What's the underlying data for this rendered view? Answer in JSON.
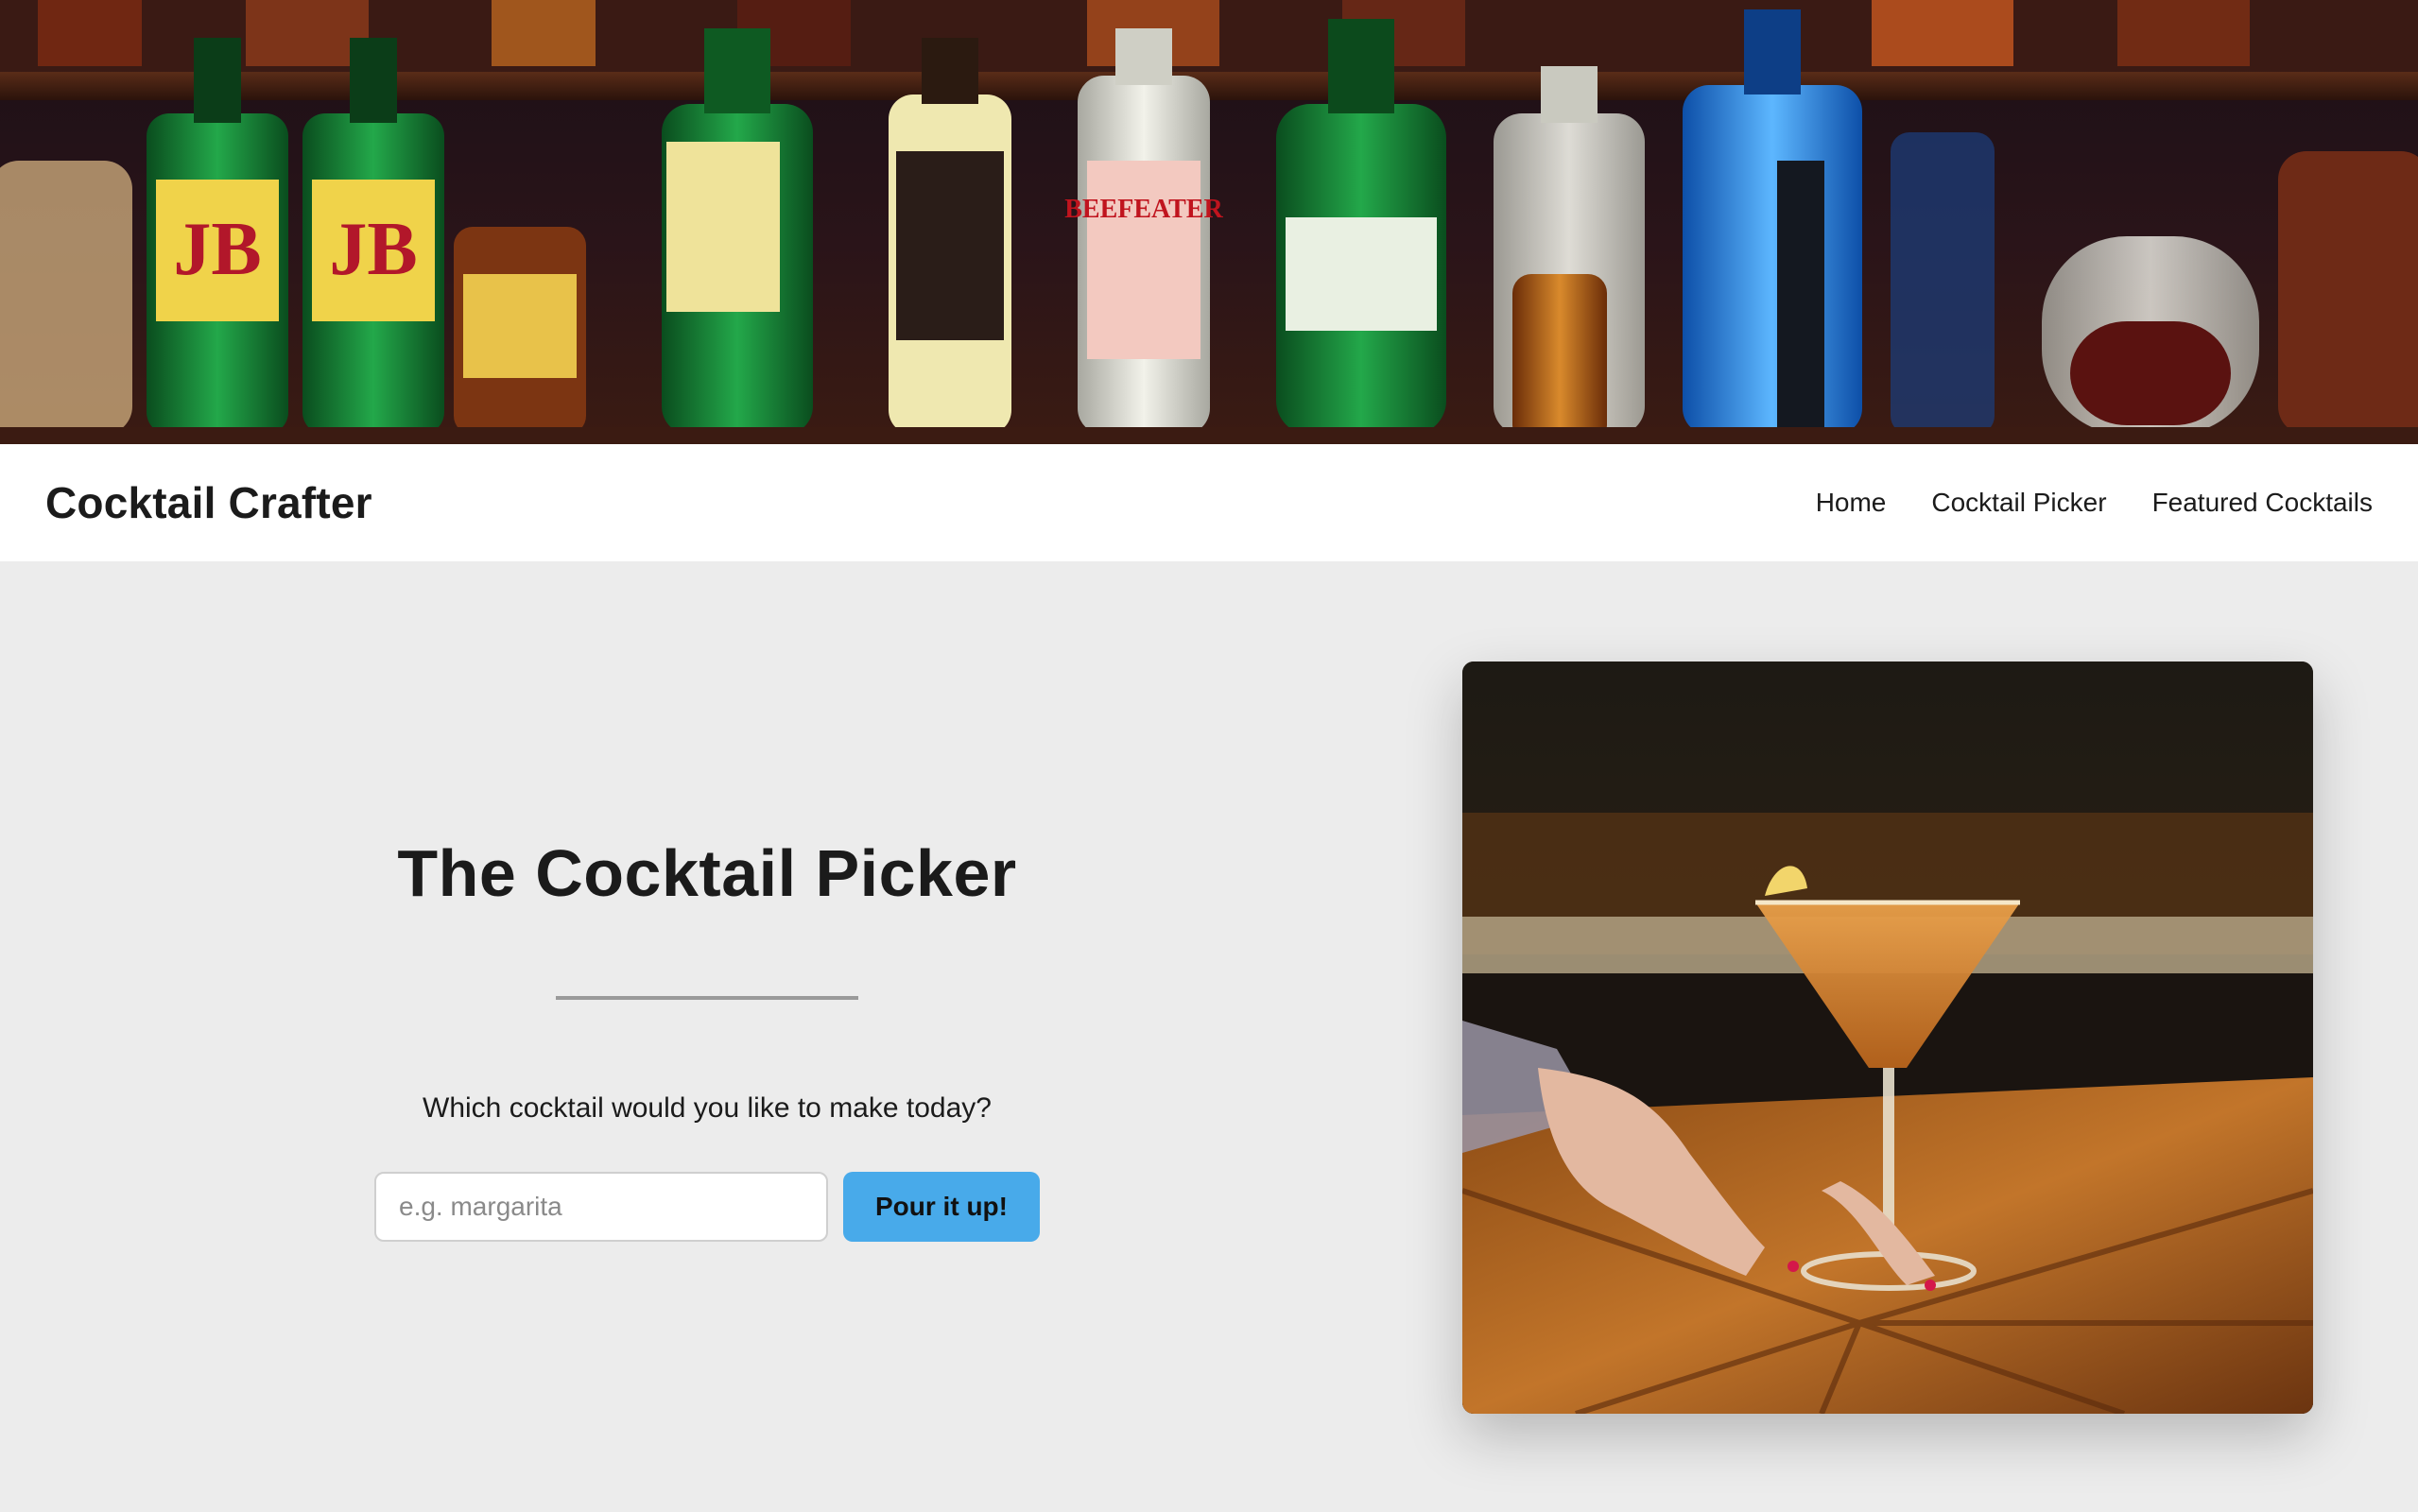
{
  "hero": {
    "image": "bar-shelf-liquor-bottles"
  },
  "nav": {
    "brand": "Cocktail Crafter",
    "links": [
      "Home",
      "Cocktail Picker",
      "Featured Cocktails"
    ]
  },
  "picker": {
    "title": "The Cocktail Picker",
    "question": "Which cocktail would you like to make today?",
    "input_placeholder": "e.g. margarita",
    "input_value": "",
    "button_label": "Pour it up!"
  },
  "photo": {
    "image": "cocktail-glass-on-wooden-bar"
  },
  "colors": {
    "accent": "#48aaea",
    "page_bg": "#ececec",
    "nav_bg": "#ffffff"
  }
}
